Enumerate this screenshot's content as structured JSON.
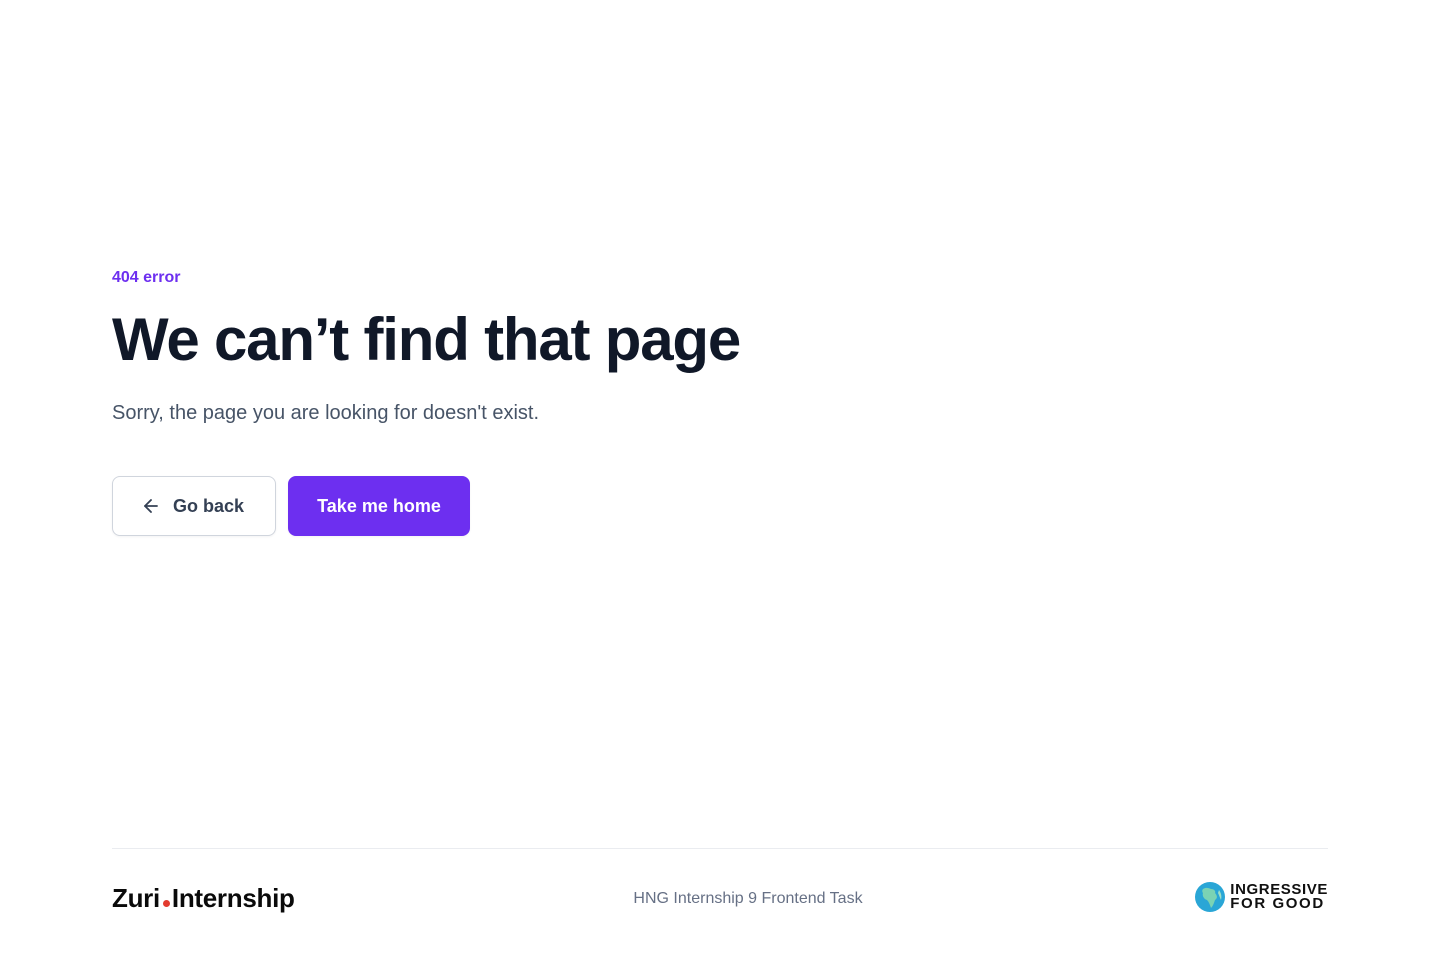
{
  "main": {
    "eyebrow": "404 error",
    "title": "We can’t find that page",
    "subtitle": "Sorry, the page you are looking for doesn't exist.",
    "buttons": {
      "back_label": "Go back",
      "back_icon": "arrow-left-icon",
      "home_label": "Take me home"
    }
  },
  "footer": {
    "logo_left_a": "Zuri",
    "logo_left_b": "Internship",
    "center_text": "HNG Internship 9 Frontend Task",
    "logo_right_line1": "INGRESSIVE",
    "logo_right_line2": "FOR GOOD"
  },
  "colors": {
    "accent": "#6d2ff0",
    "heading": "#101828",
    "body": "#475467",
    "zuri_dot": "#e33b2f"
  }
}
